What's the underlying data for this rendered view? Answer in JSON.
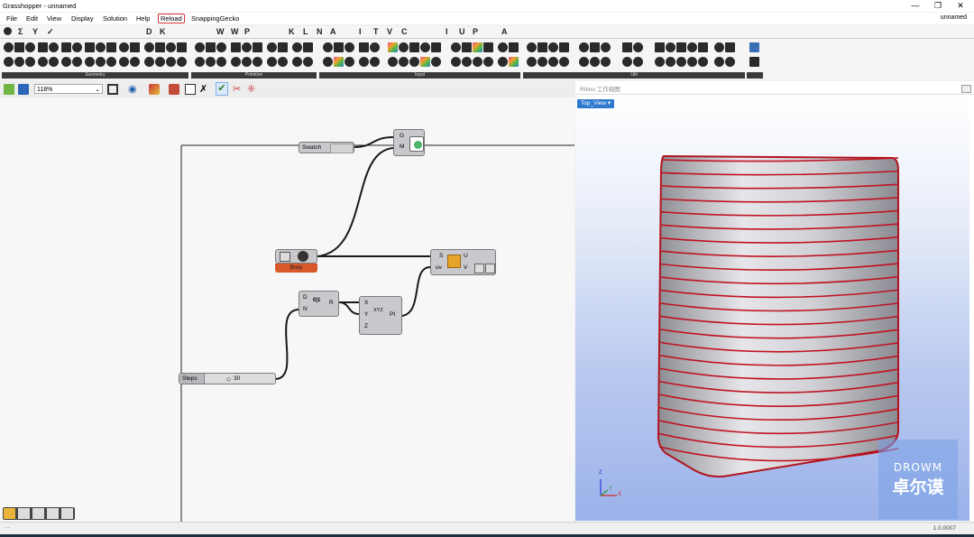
{
  "window": {
    "title": "Grasshopper - unnamed",
    "doc_name": "unnamed",
    "minimize_glyph": "—",
    "restore_glyph": "❐",
    "close_glyph": "✕"
  },
  "menu": [
    "File",
    "Edit",
    "View",
    "Display",
    "Solution",
    "Help",
    "Reload",
    "SnappingGecko"
  ],
  "categories": [
    "Σ",
    "Y",
    "✓",
    "D",
    "K",
    "W",
    "W",
    "P",
    "K",
    "L",
    "N",
    "A",
    "I",
    "T",
    "V",
    "C",
    "I",
    "U",
    "P",
    "A"
  ],
  "ribbon_groups": [
    "Geometry",
    "Primitive",
    "Input",
    "Util"
  ],
  "toolbar": {
    "zoom": "118%"
  },
  "canvas": {
    "swatch_label": "Swatch",
    "preview_inputs": [
      "G",
      "M"
    ],
    "brep_label": "Brep",
    "isotrim": {
      "inputs": [
        "S",
        "uv"
      ],
      "outputs": [
        "U",
        "V"
      ]
    },
    "range": {
      "inputs": [
        "D",
        "N"
      ],
      "output": "R",
      "icon_text": "0|1"
    },
    "construct_point": {
      "inputs": [
        "X",
        "Y",
        "Z"
      ],
      "output": "Pt",
      "icon_text": "XYZ"
    },
    "slider": {
      "label": "Steps",
      "value": "30"
    }
  },
  "rhino": {
    "title": "Rhino 工作视图",
    "viewport_label": "Top_View",
    "watermark_en": "DROWM",
    "watermark_cn": "卓尔谟",
    "axes": {
      "z": "Z",
      "x": "X",
      "y": "Y"
    }
  },
  "status": {
    "version": "1.0.0007"
  },
  "colors": {
    "brep_param": "#d9582a",
    "wire": "#1a1a1a",
    "section_curve": "#c0131f",
    "viewport_label_bg": "#2f78d0",
    "ribbon_label_bg": "#3a3a3a"
  }
}
